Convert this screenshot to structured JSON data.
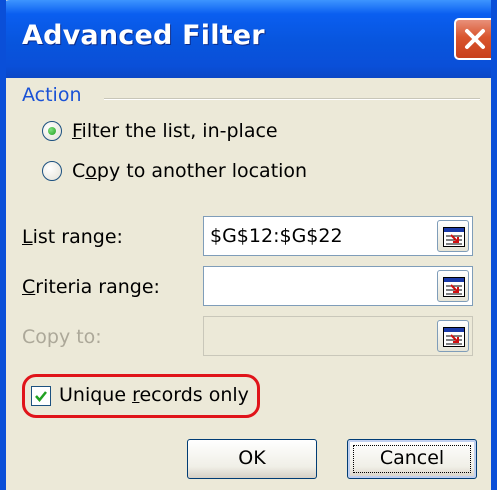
{
  "window": {
    "title": "Advanced Filter"
  },
  "action_group": {
    "label": "Action",
    "options": [
      {
        "mnemonic": "F",
        "rest": "ilter the list, in-place",
        "selected": true
      },
      {
        "mnemonic_prefix": "C",
        "mnemonic": "o",
        "rest": "py to another location",
        "selected": false
      }
    ]
  },
  "fields": {
    "list_range": {
      "mnemonic": "L",
      "rest": "ist range:",
      "value": "$G$12:$G$22"
    },
    "criteria_range": {
      "mnemonic": "C",
      "rest": "riteria range:",
      "value": ""
    },
    "copy_to": {
      "label": "Copy to:",
      "value": "",
      "disabled": true
    }
  },
  "unique_records": {
    "prefix": "Unique ",
    "mnemonic": "r",
    "rest": "ecords only",
    "checked": true
  },
  "buttons": {
    "ok": "OK",
    "cancel": "Cancel"
  },
  "colors": {
    "titlebar": "#0a4fd8",
    "dialog_bg": "#ece9d8",
    "group_label": "#1a52d6",
    "highlight": "#e0141a",
    "close_button": "#d9552e"
  },
  "icons": {
    "close": "close-icon",
    "range_selector": "collapse-dialog-icon",
    "check": "checkmark-icon"
  }
}
